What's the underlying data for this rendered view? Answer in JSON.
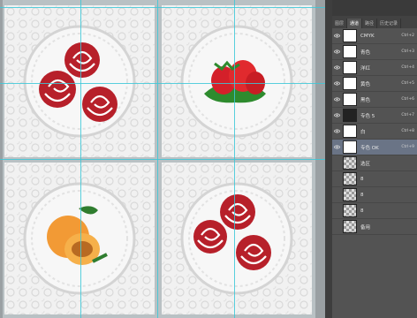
{
  "panel": {
    "tabs": [
      "图层",
      "通道",
      "路径",
      "历史记录"
    ],
    "active_tab": 1
  },
  "channels": [
    {
      "name": "CMYK",
      "key": "Ctrl+2",
      "visible": true,
      "thumb": "white"
    },
    {
      "name": "青色",
      "key": "Ctrl+3",
      "visible": true,
      "thumb": "white"
    },
    {
      "name": "洋红",
      "key": "Ctrl+4",
      "visible": true,
      "thumb": "white"
    },
    {
      "name": "黄色",
      "key": "Ctrl+5",
      "visible": true,
      "thumb": "white"
    },
    {
      "name": "黑色",
      "key": "Ctrl+6",
      "visible": true,
      "thumb": "white"
    },
    {
      "name": "专色 5",
      "key": "Ctrl+7",
      "visible": true,
      "thumb": "dark"
    },
    {
      "name": "白",
      "key": "Ctrl+8",
      "visible": true,
      "thumb": "white"
    },
    {
      "name": "专色 OK",
      "key": "Ctrl+9",
      "visible": true,
      "thumb": "white",
      "selected": true
    },
    {
      "name": "选区",
      "key": "",
      "visible": false,
      "thumb": "pat"
    },
    {
      "name": "8",
      "key": "",
      "visible": false,
      "thumb": "pat"
    },
    {
      "name": "8",
      "key": "",
      "visible": false,
      "thumb": "pat"
    },
    {
      "name": "8",
      "key": "",
      "visible": false,
      "thumb": "pat"
    },
    {
      "name": "备用",
      "key": "",
      "visible": false,
      "thumb": "pat"
    }
  ]
}
